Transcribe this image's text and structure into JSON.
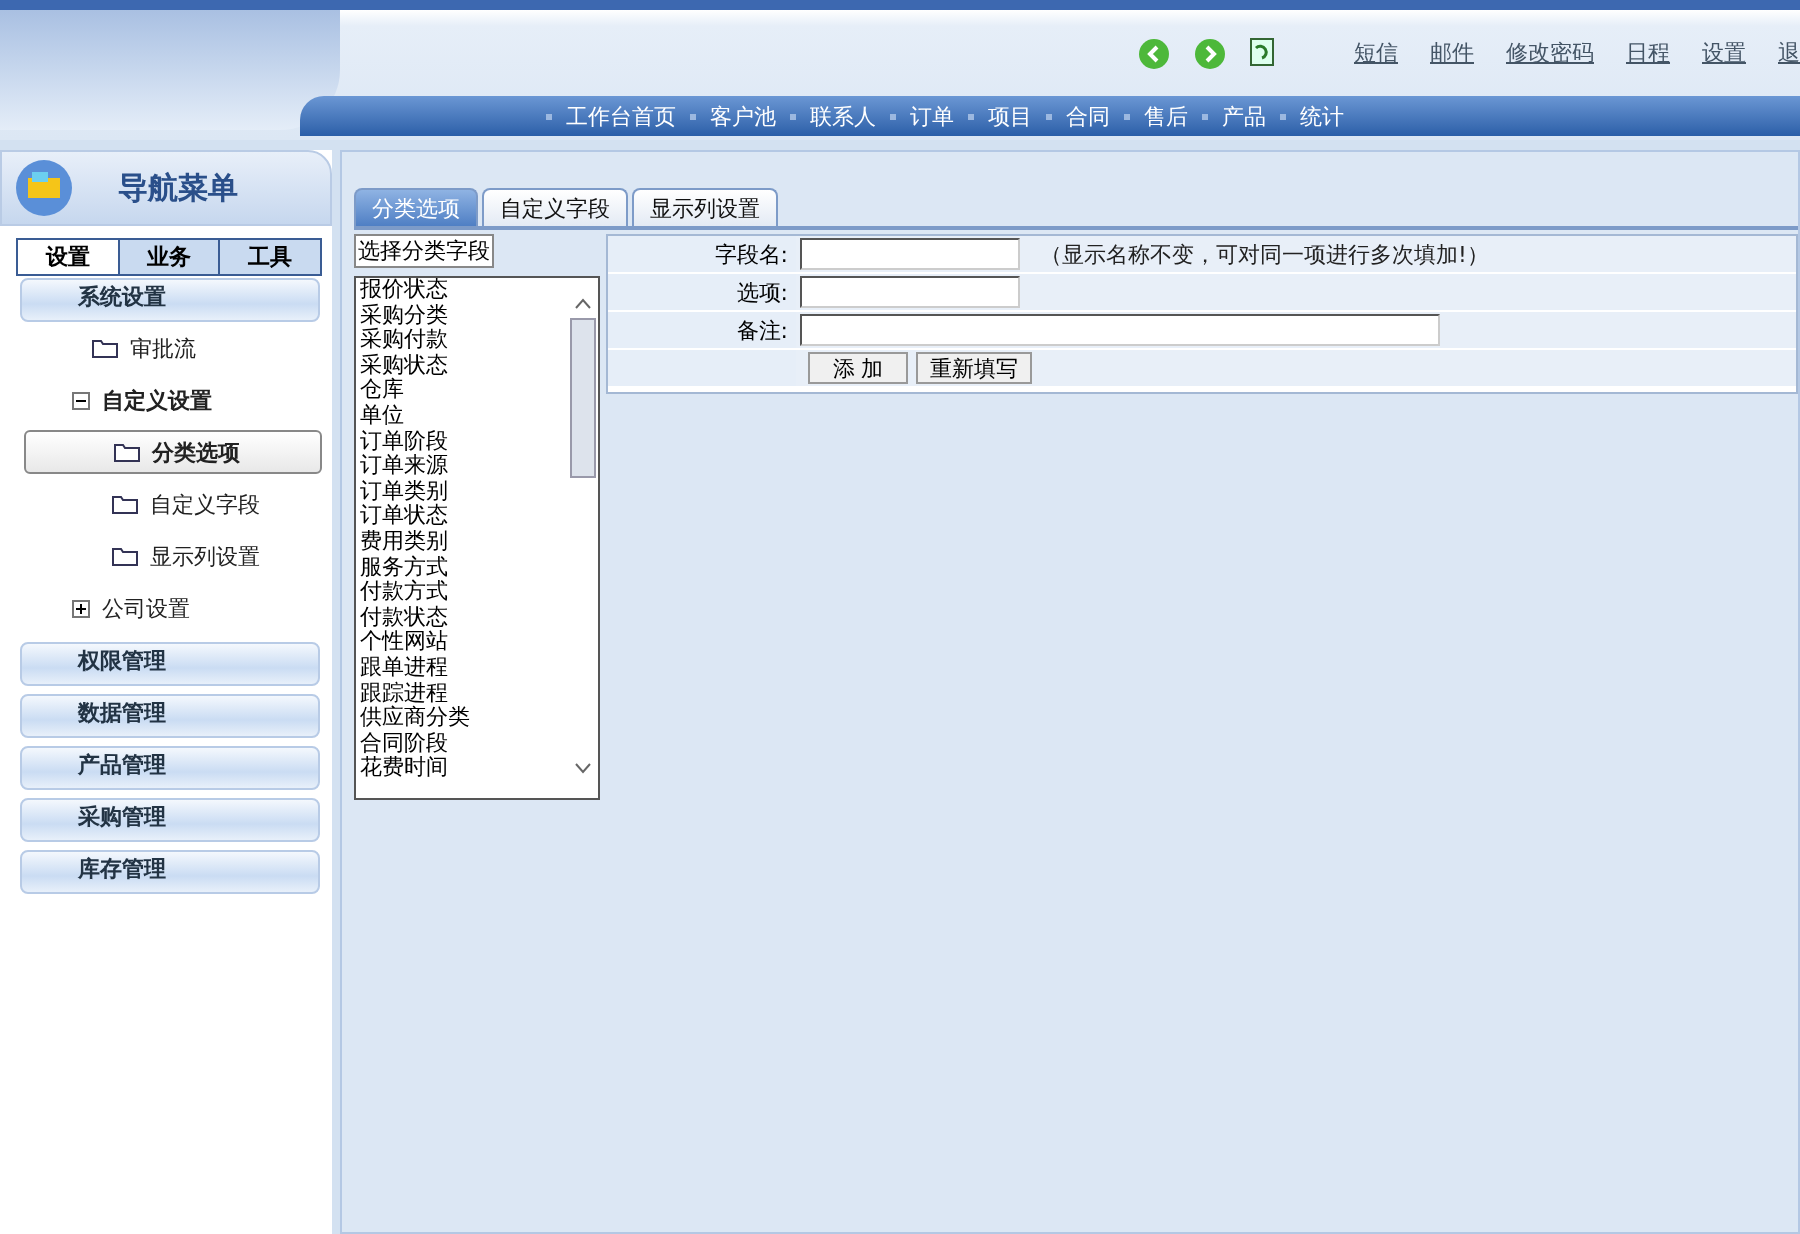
{
  "header": {
    "top_links": [
      "短信",
      "邮件",
      "修改密码",
      "日程",
      "设置",
      "退"
    ],
    "nav_items": [
      "工作台首页",
      "客户池",
      "联系人",
      "订单",
      "项目",
      "合同",
      "售后",
      "产品",
      "统计"
    ]
  },
  "sidebar": {
    "title": "导航菜单",
    "tabs": [
      {
        "label": "设置",
        "selected": true
      },
      {
        "label": "业务",
        "selected": false
      },
      {
        "label": "工具",
        "selected": false
      }
    ],
    "sections": [
      {
        "label": "系统设置",
        "children": [
          {
            "kind": "leaf",
            "label": "审批流",
            "selected": false
          },
          {
            "kind": "group",
            "label": "自定义设置",
            "expanded": true,
            "children": [
              {
                "kind": "leaf",
                "label": "分类选项",
                "selected": true
              },
              {
                "kind": "leaf",
                "label": "自定义字段",
                "selected": false
              },
              {
                "kind": "leaf",
                "label": "显示列设置",
                "selected": false
              }
            ]
          },
          {
            "kind": "group",
            "label": "公司设置",
            "expanded": false
          }
        ]
      },
      {
        "label": "权限管理"
      },
      {
        "label": "数据管理"
      },
      {
        "label": "产品管理"
      },
      {
        "label": "采购管理"
      },
      {
        "label": "库存管理"
      }
    ]
  },
  "main": {
    "tabs": [
      {
        "label": "分类选项",
        "selected": true
      },
      {
        "label": "自定义字段",
        "selected": false
      },
      {
        "label": "显示列设置",
        "selected": false
      }
    ],
    "list_title": "选择分类字段",
    "list_items": [
      "报价状态",
      "采购分类",
      "采购付款",
      "采购状态",
      "仓库",
      "单位",
      "订单阶段",
      "订单来源",
      "订单类别",
      "订单状态",
      "费用类别",
      "服务方式",
      "付款方式",
      "付款状态",
      "个性网站",
      "跟单进程",
      "跟踪进程",
      "供应商分类",
      "合同阶段",
      "花费时间"
    ],
    "form": {
      "fields": [
        {
          "label": "字段名:",
          "kind": "short",
          "hint": "（显示名称不变，可对同一项进行多次填加!）"
        },
        {
          "label": "选项:",
          "kind": "short"
        },
        {
          "label": "备注:",
          "kind": "long"
        }
      ],
      "buttons": [
        "添 加",
        "重新填写"
      ]
    }
  }
}
